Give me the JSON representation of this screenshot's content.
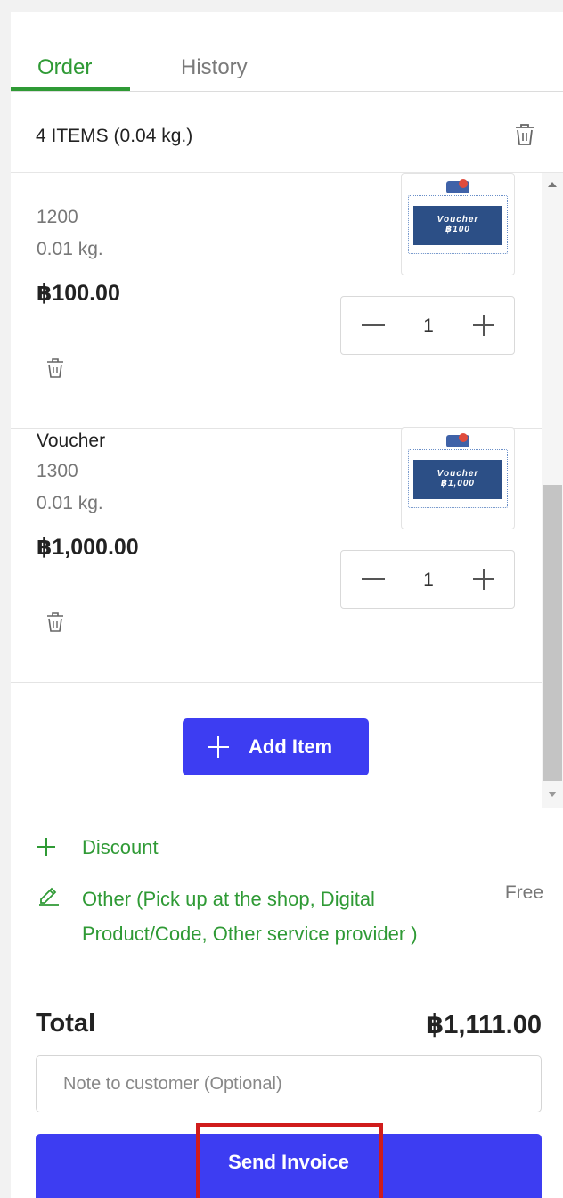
{
  "tabs": [
    {
      "label": "Order",
      "active": true
    },
    {
      "label": "History",
      "active": false
    }
  ],
  "cart": {
    "summary": "4 ITEMS (0.04 kg.)"
  },
  "items": [
    {
      "name": "",
      "sku": "1200",
      "weight": "0.01 kg.",
      "price": "฿100.00",
      "quantity": "1",
      "thumb_text_line1": "Voucher",
      "thumb_text_line2": "฿100"
    },
    {
      "name": "Voucher",
      "sku": "1300",
      "weight": "0.01 kg.",
      "price": "฿1,000.00",
      "quantity": "1",
      "thumb_text_line1": "Voucher",
      "thumb_text_line2": "฿1,000"
    }
  ],
  "add_item": {
    "label": "Add Item"
  },
  "discount": {
    "label": "Discount"
  },
  "shipping": {
    "label": "Other (Pick up at the shop, Digital Product/Code, Other service provider )",
    "price": "Free"
  },
  "total": {
    "label": "Total",
    "value": "฿1,111.00"
  },
  "note": {
    "placeholder": "Note to customer (Optional)"
  },
  "send": {
    "label": "Send Invoice"
  },
  "colors": {
    "accent_green": "#2f9a35",
    "primary_blue": "#3d3df2",
    "highlight_red": "#d01c1c"
  }
}
